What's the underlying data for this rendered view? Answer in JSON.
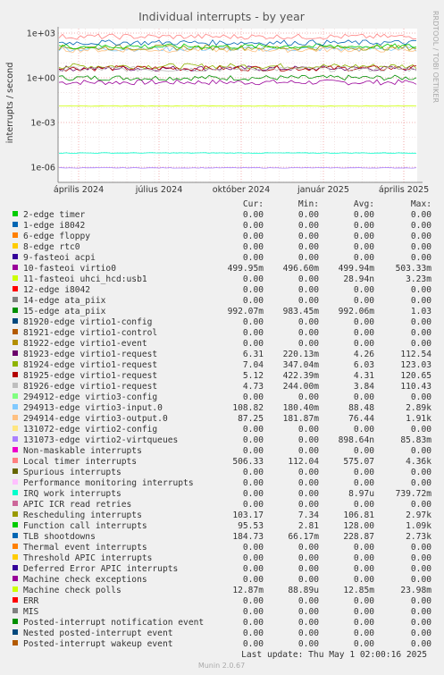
{
  "chart_data": {
    "type": "line",
    "title": "Individual interrupts - by year",
    "ylabel": "interrupts / second",
    "side_label": "RRDTOOL / TOBI OETIKER",
    "y_scale": "log",
    "y_ticks": [
      "1e+03",
      "1e+00",
      "1e-03",
      "1e-06"
    ],
    "x_ticks": [
      "április 2024",
      "július 2024",
      "október 2024",
      "január 2025",
      "április 2025"
    ],
    "grid": true,
    "columns": [
      "Cur:",
      "Min:",
      "Avg:",
      "Max:"
    ],
    "series": [
      {
        "name": "2-edge      timer",
        "color": "#00cc00",
        "cur": "0.00",
        "min": "0.00",
        "avg": "0.00",
        "max": "0.00"
      },
      {
        "name": "1-edge      i8042",
        "color": "#0066b3",
        "cur": "0.00",
        "min": "0.00",
        "avg": "0.00",
        "max": "0.00"
      },
      {
        "name": "6-edge      floppy",
        "color": "#ff8000",
        "cur": "0.00",
        "min": "0.00",
        "avg": "0.00",
        "max": "0.00"
      },
      {
        "name": "8-edge      rtc0",
        "color": "#ffcc00",
        "cur": "0.00",
        "min": "0.00",
        "avg": "0.00",
        "max": "0.00"
      },
      {
        "name": "9-fasteoi   acpi",
        "color": "#330099",
        "cur": "0.00",
        "min": "0.00",
        "avg": "0.00",
        "max": "0.00"
      },
      {
        "name": "10-fasteoi   virtio0",
        "color": "#990099",
        "cur": "499.95m",
        "min": "496.60m",
        "avg": "499.94m",
        "max": "503.33m"
      },
      {
        "name": "11-fasteoi   uhci_hcd:usb1",
        "color": "#ccff00",
        "cur": "0.00",
        "min": "0.00",
        "avg": "28.94n",
        "max": "3.23m"
      },
      {
        "name": "12-edge      i8042",
        "color": "#ff0000",
        "cur": "0.00",
        "min": "0.00",
        "avg": "0.00",
        "max": "0.00"
      },
      {
        "name": "14-edge      ata_piix",
        "color": "#808080",
        "cur": "0.00",
        "min": "0.00",
        "avg": "0.00",
        "max": "0.00"
      },
      {
        "name": "15-edge      ata_piix",
        "color": "#008f00",
        "cur": "992.07m",
        "min": "983.45m",
        "avg": "992.06m",
        "max": "1.03"
      },
      {
        "name": "81920-edge      virtio1-config",
        "color": "#00487d",
        "cur": "0.00",
        "min": "0.00",
        "avg": "0.00",
        "max": "0.00"
      },
      {
        "name": "81921-edge      virtio1-control",
        "color": "#b35a00",
        "cur": "0.00",
        "min": "0.00",
        "avg": "0.00",
        "max": "0.00"
      },
      {
        "name": "81922-edge      virtio1-event",
        "color": "#b38f00",
        "cur": "0.00",
        "min": "0.00",
        "avg": "0.00",
        "max": "0.00"
      },
      {
        "name": "81923-edge      virtio1-request",
        "color": "#6b006b",
        "cur": "6.31",
        "min": "220.13m",
        "avg": "4.26",
        "max": "112.54"
      },
      {
        "name": "81924-edge      virtio1-request",
        "color": "#8fb300",
        "cur": "7.04",
        "min": "347.04m",
        "avg": "6.03",
        "max": "123.03"
      },
      {
        "name": "81925-edge      virtio1-request",
        "color": "#b30000",
        "cur": "5.12",
        "min": "422.39m",
        "avg": "4.31",
        "max": "120.65"
      },
      {
        "name": "81926-edge      virtio1-request",
        "color": "#bebebe",
        "cur": "4.73",
        "min": "244.00m",
        "avg": "3.84",
        "max": "110.43"
      },
      {
        "name": "294912-edge      virtio3-config",
        "color": "#80ff80",
        "cur": "0.00",
        "min": "0.00",
        "avg": "0.00",
        "max": "0.00"
      },
      {
        "name": "294913-edge      virtio3-input.0",
        "color": "#80c9ff",
        "cur": "108.82",
        "min": "180.40m",
        "avg": "88.48",
        "max": "2.89k"
      },
      {
        "name": "294914-edge      virtio3-output.0",
        "color": "#ffc080",
        "cur": "87.25",
        "min": "181.87m",
        "avg": "76.44",
        "max": "1.91k"
      },
      {
        "name": "131072-edge      virtio2-config",
        "color": "#ffe680",
        "cur": "0.00",
        "min": "0.00",
        "avg": "0.00",
        "max": "0.00"
      },
      {
        "name": "131073-edge      virtio2-virtqueues",
        "color": "#aa80ff",
        "cur": "0.00",
        "min": "0.00",
        "avg": "898.64n",
        "max": "85.83m"
      },
      {
        "name": "Non-maskable interrupts",
        "color": "#ee00cc",
        "cur": "0.00",
        "min": "0.00",
        "avg": "0.00",
        "max": "0.00"
      },
      {
        "name": "Local timer interrupts",
        "color": "#ff8080",
        "cur": "506.33",
        "min": "112.04",
        "avg": "575.07",
        "max": "4.36k"
      },
      {
        "name": "Spurious interrupts",
        "color": "#666600",
        "cur": "0.00",
        "min": "0.00",
        "avg": "0.00",
        "max": "0.00"
      },
      {
        "name": "Performance monitoring interrupts",
        "color": "#ffbfff",
        "cur": "0.00",
        "min": "0.00",
        "avg": "0.00",
        "max": "0.00"
      },
      {
        "name": "IRQ work interrupts",
        "color": "#00ffcc",
        "cur": "0.00",
        "min": "0.00",
        "avg": "8.97u",
        "max": "739.72m"
      },
      {
        "name": "APIC ICR read retries",
        "color": "#cc6699",
        "cur": "0.00",
        "min": "0.00",
        "avg": "0.00",
        "max": "0.00"
      },
      {
        "name": "Rescheduling interrupts",
        "color": "#999900",
        "cur": "103.17",
        "min": "7.34",
        "avg": "106.81",
        "max": "2.97k"
      },
      {
        "name": "Function call interrupts",
        "color": "#00cc00",
        "cur": "95.53",
        "min": "2.81",
        "avg": "128.00",
        "max": "1.09k"
      },
      {
        "name": "TLB shootdowns",
        "color": "#0066b3",
        "cur": "184.73",
        "min": "66.17m",
        "avg": "228.87",
        "max": "2.73k"
      },
      {
        "name": "Thermal event interrupts",
        "color": "#ff8000",
        "cur": "0.00",
        "min": "0.00",
        "avg": "0.00",
        "max": "0.00"
      },
      {
        "name": "Threshold APIC interrupts",
        "color": "#ffcc00",
        "cur": "0.00",
        "min": "0.00",
        "avg": "0.00",
        "max": "0.00"
      },
      {
        "name": "Deferred Error APIC interrupts",
        "color": "#330099",
        "cur": "0.00",
        "min": "0.00",
        "avg": "0.00",
        "max": "0.00"
      },
      {
        "name": "Machine check exceptions",
        "color": "#990099",
        "cur": "0.00",
        "min": "0.00",
        "avg": "0.00",
        "max": "0.00"
      },
      {
        "name": "Machine check polls",
        "color": "#ccff00",
        "cur": "12.87m",
        "min": "88.89u",
        "avg": "12.85m",
        "max": "23.98m"
      },
      {
        "name": "ERR",
        "color": "#ff0000",
        "cur": "0.00",
        "min": "0.00",
        "avg": "0.00",
        "max": "0.00"
      },
      {
        "name": "MIS",
        "color": "#808080",
        "cur": "0.00",
        "min": "0.00",
        "avg": "0.00",
        "max": "0.00"
      },
      {
        "name": "Posted-interrupt notification event",
        "color": "#008f00",
        "cur": "0.00",
        "min": "0.00",
        "avg": "0.00",
        "max": "0.00"
      },
      {
        "name": "Nested posted-interrupt event",
        "color": "#00487d",
        "cur": "0.00",
        "min": "0.00",
        "avg": "0.00",
        "max": "0.00"
      },
      {
        "name": "Posted-interrupt wakeup event",
        "color": "#b35a00",
        "cur": "0.00",
        "min": "0.00",
        "avg": "0.00",
        "max": "0.00"
      }
    ]
  },
  "footer": {
    "last_update": "Last update: Thu May  1 02:00:16 2025",
    "munin": "Munin 2.0.67"
  }
}
